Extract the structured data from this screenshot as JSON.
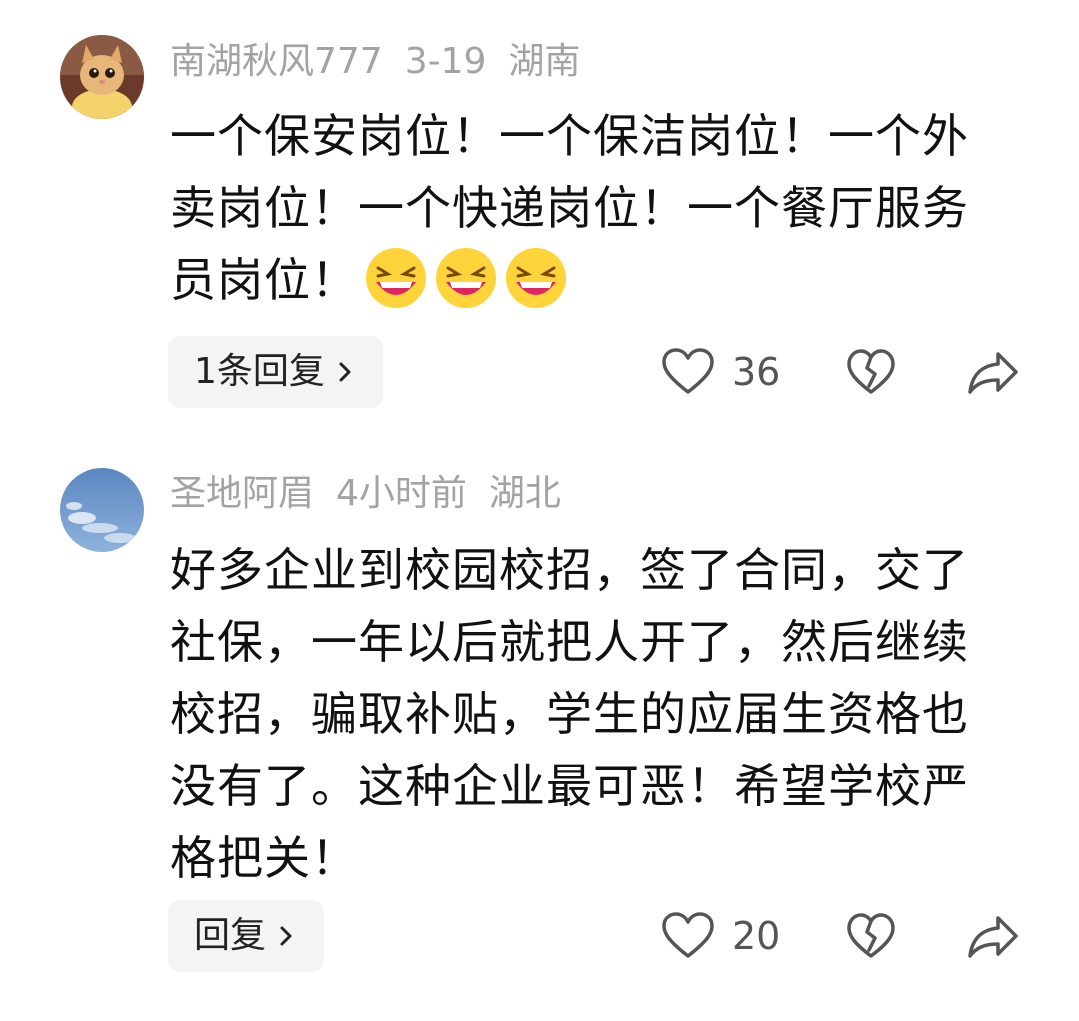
{
  "comments": [
    {
      "author": "南湖秋风777",
      "date": "3-19",
      "location": "湖南",
      "text": "一个保安岗位！一个保洁岗位！一个外卖岗位！一个快递岗位！一个餐厅服务员岗位！",
      "emojis": [
        "laughing-emoji",
        "laughing-emoji",
        "laughing-emoji"
      ],
      "reply_label": "1条回复",
      "like_count": "36"
    },
    {
      "author": "圣地阿眉",
      "date": "4小时前",
      "location": "湖北",
      "text": "好多企业到校园校招，签了合同，交了社保，一年以后就把人开了，然后继续校招，骗取补贴，学生的应届生资格也没有了。这种企业最可恶！希望学校严格把关！",
      "reply_label": "回复",
      "like_count": "20"
    }
  ],
  "icons": {
    "like": "heart-outline-icon",
    "dislike": "broken-heart-icon",
    "share": "share-arrow-icon",
    "chevron": "chevron-right-icon"
  },
  "colors": {
    "meta_text": "#a3a3a3",
    "icon": "#555555",
    "reply_bg": "#f4f4f4"
  }
}
